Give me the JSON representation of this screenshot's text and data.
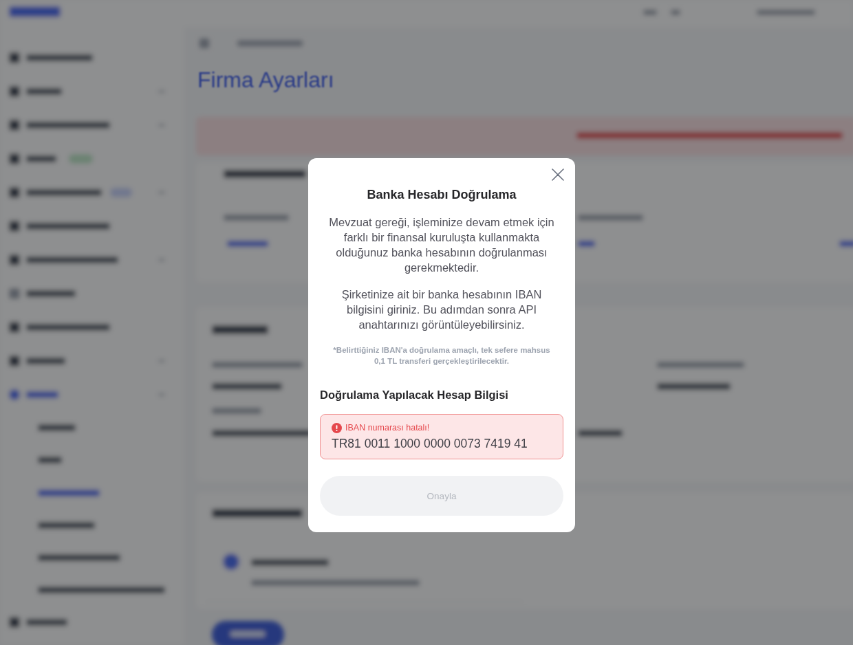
{
  "background": {
    "page_title": "Firma Ayarları"
  },
  "dialog": {
    "title": "Banka Hesabı Doğrulama",
    "paragraphs": [
      "Mevzuat gereği, işleminize devam etmek için farklı bir finansal kuruluşta kullanmakta olduğunuz banka hesabının doğrulanması gerekmektedir.",
      "Şirketinize ait bir banka hesabının IBAN bilgisini giriniz. Bu adımdan sonra API anahtarınızı görüntüleyebilirsiniz."
    ],
    "note": "*Belirttiğiniz IBAN'a doğrulama amaçlı, tek sefere mahsus 0,1 TL transferi gerçekleştirilecektir.",
    "section_title": "Doğrulama Yapılacak Hesap Bilgisi",
    "iban_field": {
      "invalid": true,
      "error": "IBAN numarası hatalı!",
      "value": "TR81 0011 1000 0000 0073 7419 41"
    },
    "confirm_button": {
      "label": "Onayla",
      "disabled": true
    }
  }
}
